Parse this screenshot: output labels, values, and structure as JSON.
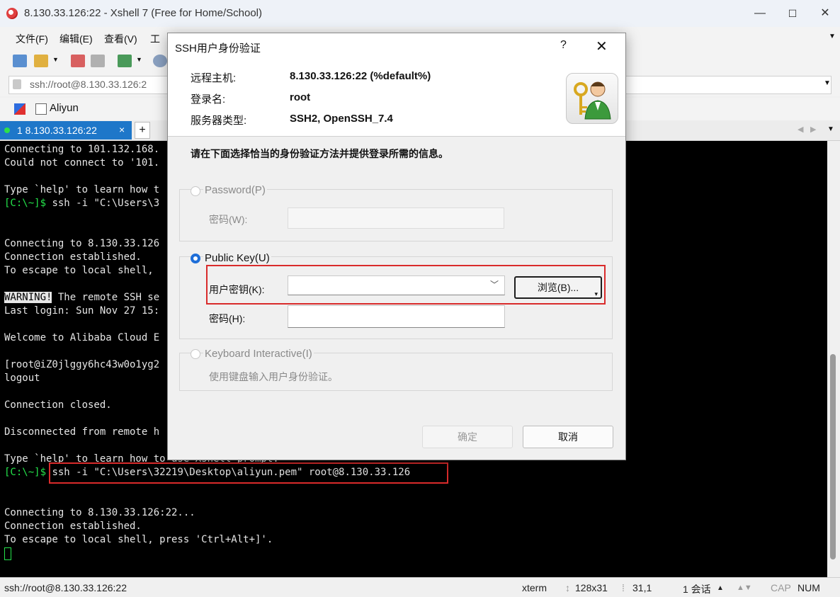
{
  "window": {
    "title": "8.130.33.126:22 - Xshell 7 (Free for Home/School)",
    "minimize": "—",
    "maximize": "☐",
    "close": "✕"
  },
  "menus": [
    "文件(F)",
    "编辑(E)",
    "查看(V)",
    "工"
  ],
  "address": {
    "value": "ssh://root@8.130.33.126:2"
  },
  "links": {
    "aliyun": "Aliyun"
  },
  "tabs": [
    {
      "label": "1 8.130.33.126:22",
      "close": "×"
    }
  ],
  "tab_add": "+",
  "terminal": {
    "lines": [
      "Connecting to 101.132.168.",
      "Could not connect to '101.",
      "",
      "Type `help' to learn how t",
      "[C:\\~]$ ssh -i \"C:\\Users\\3",
      "",
      "",
      "Connecting to 8.130.33.126",
      "Connection established.",
      "To escape to local shell,",
      "",
      "WARNING! The remote SSH se",
      "Last login: Sun Nov 27 15:",
      "",
      "Welcome to Alibaba Cloud E",
      "",
      "[root@iZ0jlggy6hc43w0o1yg2",
      "logout",
      "",
      "Connection closed.",
      "",
      "Disconnected from remote h",
      "",
      "Type `help' to learn how to use Xshell prompt.",
      "[C:\\~]$ ssh -i \"C:\\Users\\32219\\Desktop\\aliyun.pem\" root@8.130.33.126",
      "",
      "",
      "Connecting to 8.130.33.126:22...",
      "Connection established.",
      "To escape to local shell, press 'Ctrl+Alt+]'."
    ],
    "prompt": "[C:\\~]$",
    "warning": "WARNING!",
    "warning_rest": " The remote SSH se",
    "cmd_prev": " ssh -i \"C:\\Users\\3",
    "cmd_last": " ssh -i \"C:\\Users\\32219\\Desktop\\aliyun.pem\" root@8.130.33.126"
  },
  "status": {
    "connection": "ssh://root@8.130.33.126:22",
    "term": "xterm",
    "size": "128x31",
    "cursor_pos": "31,1",
    "sessions": "1 会话",
    "cap": "CAP",
    "num": "NUM"
  },
  "dialog": {
    "title": "SSH用户身份验证",
    "help": "?",
    "close": "✕",
    "info": [
      {
        "label": "远程主机:",
        "value": "8.130.33.126:22 (%default%)"
      },
      {
        "label": "登录名:",
        "value": "root"
      },
      {
        "label": "服务器类型:",
        "value": "SSH2, OpenSSH_7.4"
      }
    ],
    "instruction": "请在下面选择恰当的身份验证方法并提供登录所需的信息。",
    "password_option": {
      "label": "Password(P)",
      "field_label": "密码(W):",
      "value": ""
    },
    "publickey_option": {
      "label": "Public Key(U)",
      "key_label": "用户密钥(K):",
      "key_value": "",
      "browse": "浏览(B)...",
      "pass_label": "密码(H):",
      "pass_value": ""
    },
    "keyboard_option": {
      "label": "Keyboard Interactive(I)",
      "desc": "使用键盘输入用户身份验证。"
    },
    "ok": "确定",
    "cancel": "取消"
  },
  "colors": {
    "accent": "#1e77c9",
    "highlight": "#d92b2b",
    "terminal_green": "#24e24a"
  }
}
